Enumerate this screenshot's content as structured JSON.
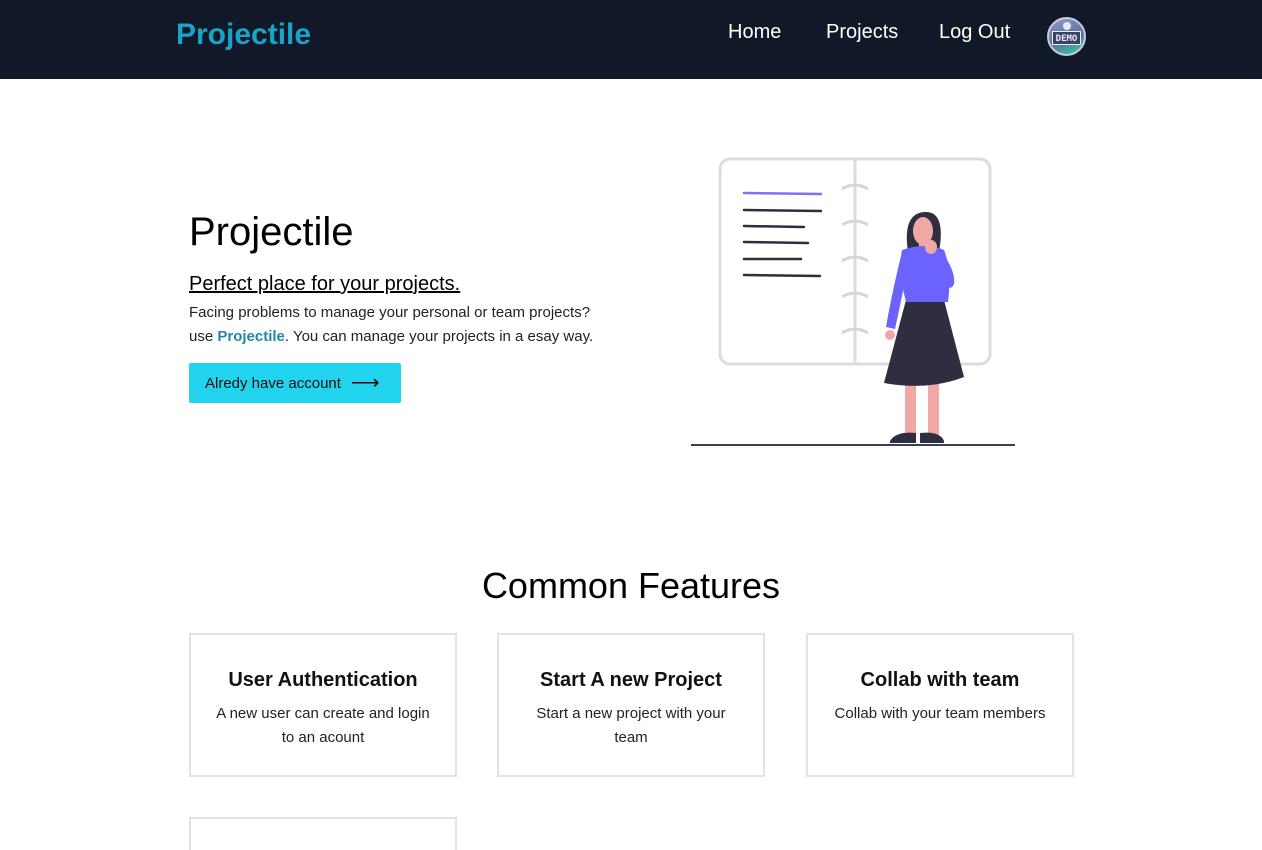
{
  "navbar": {
    "brand": "Projectile",
    "links": [
      "Home",
      "Projects",
      "Log Out"
    ],
    "avatar_label": "DEMO"
  },
  "hero": {
    "title": "Projectile",
    "tagline": "Perfect place for your projects.",
    "description_line1": "Facing problems to manage your personal or team projects?",
    "description_prefix": "use ",
    "description_brand": "Projectile",
    "description_suffix": ". You can manage your projects in a esay way.",
    "cta_label": "Alredy have account",
    "cta_icon": "arrow-right-icon"
  },
  "features": {
    "title": "Common Features",
    "cards": [
      {
        "title": "User Authentication",
        "description": "A new user can create and login to an acount"
      },
      {
        "title": "Start A new Project",
        "description": "Start a new project with your team"
      },
      {
        "title": "Collab with team",
        "description": "Collab with your team members"
      }
    ]
  },
  "colors": {
    "navbar_bg": "#111827",
    "brand": "#1aa3c9",
    "cta_bg": "#22d3ee",
    "illustration_accent": "#6c63ff"
  }
}
